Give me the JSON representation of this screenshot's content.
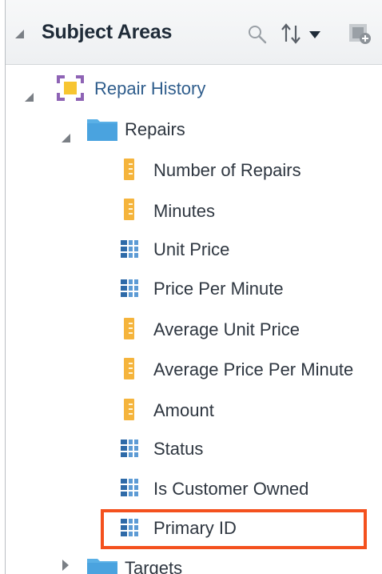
{
  "panel": {
    "title": "Subject Areas",
    "icons": [
      "search-icon",
      "sort-icon",
      "add-subject-area-icon"
    ]
  },
  "tree": {
    "root": {
      "label": "Repair History",
      "icon": "subject-area-icon",
      "expanded": true
    },
    "folder": {
      "label": "Repairs",
      "icon": "folder-icon",
      "expanded": true
    },
    "items": [
      {
        "label": "Number of Repairs",
        "type": "measure"
      },
      {
        "label": "Minutes",
        "type": "measure"
      },
      {
        "label": "Unit Price",
        "type": "attribute"
      },
      {
        "label": "Price Per Minute",
        "type": "attribute"
      },
      {
        "label": "Average Unit Price",
        "type": "measure"
      },
      {
        "label": "Average Price Per Minute",
        "type": "measure"
      },
      {
        "label": "Amount",
        "type": "measure"
      },
      {
        "label": "Status",
        "type": "attribute"
      },
      {
        "label": "Is Customer Owned",
        "type": "attribute"
      },
      {
        "label": "Primary ID",
        "type": "attribute",
        "highlighted": true
      }
    ],
    "next_folder": {
      "label": "Targets",
      "icon": "folder-icon",
      "expanded": false
    }
  },
  "colors": {
    "measure": "#f5b43c",
    "attribute": "#5d9bd5",
    "folder": "#5ab0e6",
    "highlight": "#f4511e",
    "root_label": "#2f5d8c"
  }
}
